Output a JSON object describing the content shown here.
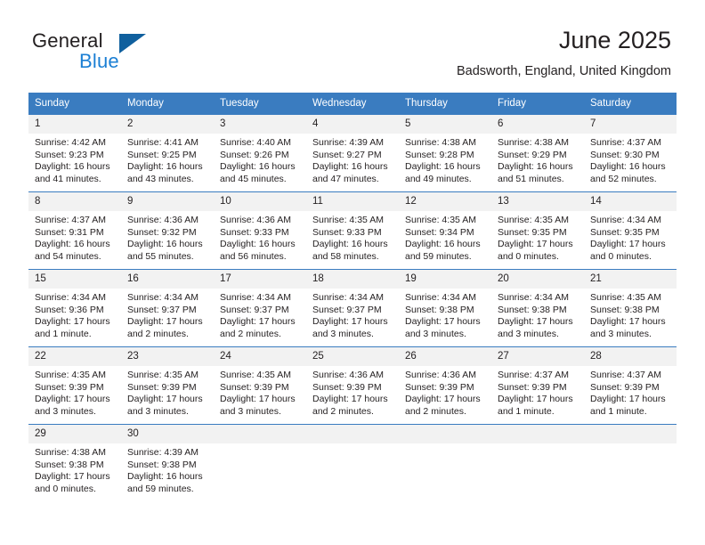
{
  "brand": {
    "name_part1": "General",
    "name_part2": "Blue",
    "accent_color": "#1b7fd4",
    "flag_color": "#10609e"
  },
  "header": {
    "title": "June 2025",
    "subtitle": "Badsworth, England, United Kingdom"
  },
  "calendar": {
    "header_bg": "#3a7cc0",
    "daynum_bg": "#f2f2f2",
    "weekday_headers": [
      "Sunday",
      "Monday",
      "Tuesday",
      "Wednesday",
      "Thursday",
      "Friday",
      "Saturday"
    ],
    "weeks": [
      [
        {
          "day": "1",
          "sunrise": "Sunrise: 4:42 AM",
          "sunset": "Sunset: 9:23 PM",
          "daylight": "Daylight: 16 hours and 41 minutes."
        },
        {
          "day": "2",
          "sunrise": "Sunrise: 4:41 AM",
          "sunset": "Sunset: 9:25 PM",
          "daylight": "Daylight: 16 hours and 43 minutes."
        },
        {
          "day": "3",
          "sunrise": "Sunrise: 4:40 AM",
          "sunset": "Sunset: 9:26 PM",
          "daylight": "Daylight: 16 hours and 45 minutes."
        },
        {
          "day": "4",
          "sunrise": "Sunrise: 4:39 AM",
          "sunset": "Sunset: 9:27 PM",
          "daylight": "Daylight: 16 hours and 47 minutes."
        },
        {
          "day": "5",
          "sunrise": "Sunrise: 4:38 AM",
          "sunset": "Sunset: 9:28 PM",
          "daylight": "Daylight: 16 hours and 49 minutes."
        },
        {
          "day": "6",
          "sunrise": "Sunrise: 4:38 AM",
          "sunset": "Sunset: 9:29 PM",
          "daylight": "Daylight: 16 hours and 51 minutes."
        },
        {
          "day": "7",
          "sunrise": "Sunrise: 4:37 AM",
          "sunset": "Sunset: 9:30 PM",
          "daylight": "Daylight: 16 hours and 52 minutes."
        }
      ],
      [
        {
          "day": "8",
          "sunrise": "Sunrise: 4:37 AM",
          "sunset": "Sunset: 9:31 PM",
          "daylight": "Daylight: 16 hours and 54 minutes."
        },
        {
          "day": "9",
          "sunrise": "Sunrise: 4:36 AM",
          "sunset": "Sunset: 9:32 PM",
          "daylight": "Daylight: 16 hours and 55 minutes."
        },
        {
          "day": "10",
          "sunrise": "Sunrise: 4:36 AM",
          "sunset": "Sunset: 9:33 PM",
          "daylight": "Daylight: 16 hours and 56 minutes."
        },
        {
          "day": "11",
          "sunrise": "Sunrise: 4:35 AM",
          "sunset": "Sunset: 9:33 PM",
          "daylight": "Daylight: 16 hours and 58 minutes."
        },
        {
          "day": "12",
          "sunrise": "Sunrise: 4:35 AM",
          "sunset": "Sunset: 9:34 PM",
          "daylight": "Daylight: 16 hours and 59 minutes."
        },
        {
          "day": "13",
          "sunrise": "Sunrise: 4:35 AM",
          "sunset": "Sunset: 9:35 PM",
          "daylight": "Daylight: 17 hours and 0 minutes."
        },
        {
          "day": "14",
          "sunrise": "Sunrise: 4:34 AM",
          "sunset": "Sunset: 9:35 PM",
          "daylight": "Daylight: 17 hours and 0 minutes."
        }
      ],
      [
        {
          "day": "15",
          "sunrise": "Sunrise: 4:34 AM",
          "sunset": "Sunset: 9:36 PM",
          "daylight": "Daylight: 17 hours and 1 minute."
        },
        {
          "day": "16",
          "sunrise": "Sunrise: 4:34 AM",
          "sunset": "Sunset: 9:37 PM",
          "daylight": "Daylight: 17 hours and 2 minutes."
        },
        {
          "day": "17",
          "sunrise": "Sunrise: 4:34 AM",
          "sunset": "Sunset: 9:37 PM",
          "daylight": "Daylight: 17 hours and 2 minutes."
        },
        {
          "day": "18",
          "sunrise": "Sunrise: 4:34 AM",
          "sunset": "Sunset: 9:37 PM",
          "daylight": "Daylight: 17 hours and 3 minutes."
        },
        {
          "day": "19",
          "sunrise": "Sunrise: 4:34 AM",
          "sunset": "Sunset: 9:38 PM",
          "daylight": "Daylight: 17 hours and 3 minutes."
        },
        {
          "day": "20",
          "sunrise": "Sunrise: 4:34 AM",
          "sunset": "Sunset: 9:38 PM",
          "daylight": "Daylight: 17 hours and 3 minutes."
        },
        {
          "day": "21",
          "sunrise": "Sunrise: 4:35 AM",
          "sunset": "Sunset: 9:38 PM",
          "daylight": "Daylight: 17 hours and 3 minutes."
        }
      ],
      [
        {
          "day": "22",
          "sunrise": "Sunrise: 4:35 AM",
          "sunset": "Sunset: 9:39 PM",
          "daylight": "Daylight: 17 hours and 3 minutes."
        },
        {
          "day": "23",
          "sunrise": "Sunrise: 4:35 AM",
          "sunset": "Sunset: 9:39 PM",
          "daylight": "Daylight: 17 hours and 3 minutes."
        },
        {
          "day": "24",
          "sunrise": "Sunrise: 4:35 AM",
          "sunset": "Sunset: 9:39 PM",
          "daylight": "Daylight: 17 hours and 3 minutes."
        },
        {
          "day": "25",
          "sunrise": "Sunrise: 4:36 AM",
          "sunset": "Sunset: 9:39 PM",
          "daylight": "Daylight: 17 hours and 2 minutes."
        },
        {
          "day": "26",
          "sunrise": "Sunrise: 4:36 AM",
          "sunset": "Sunset: 9:39 PM",
          "daylight": "Daylight: 17 hours and 2 minutes."
        },
        {
          "day": "27",
          "sunrise": "Sunrise: 4:37 AM",
          "sunset": "Sunset: 9:39 PM",
          "daylight": "Daylight: 17 hours and 1 minute."
        },
        {
          "day": "28",
          "sunrise": "Sunrise: 4:37 AM",
          "sunset": "Sunset: 9:39 PM",
          "daylight": "Daylight: 17 hours and 1 minute."
        }
      ],
      [
        {
          "day": "29",
          "sunrise": "Sunrise: 4:38 AM",
          "sunset": "Sunset: 9:38 PM",
          "daylight": "Daylight: 17 hours and 0 minutes."
        },
        {
          "day": "30",
          "sunrise": "Sunrise: 4:39 AM",
          "sunset": "Sunset: 9:38 PM",
          "daylight": "Daylight: 16 hours and 59 minutes."
        },
        {
          "day": "",
          "sunrise": "",
          "sunset": "",
          "daylight": ""
        },
        {
          "day": "",
          "sunrise": "",
          "sunset": "",
          "daylight": ""
        },
        {
          "day": "",
          "sunrise": "",
          "sunset": "",
          "daylight": ""
        },
        {
          "day": "",
          "sunrise": "",
          "sunset": "",
          "daylight": ""
        },
        {
          "day": "",
          "sunrise": "",
          "sunset": "",
          "daylight": ""
        }
      ]
    ]
  }
}
